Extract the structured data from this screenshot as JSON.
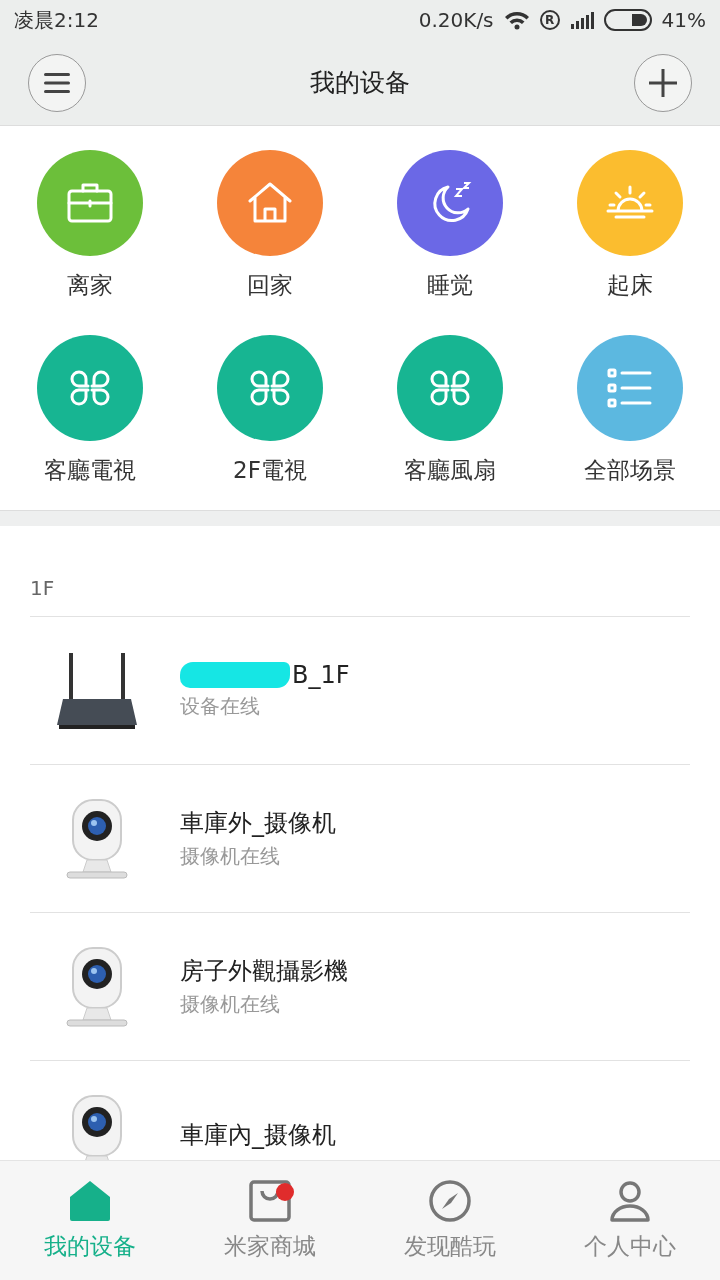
{
  "status_bar": {
    "time": "凌晨2:12",
    "speed": "0.20K/s",
    "roaming_mark": "R",
    "battery": "41%"
  },
  "header": {
    "title": "我的设备"
  },
  "scenes": [
    {
      "label": "离家",
      "kind": "briefcase",
      "color": "#6cbf3a"
    },
    {
      "label": "回家",
      "kind": "house",
      "color": "#f5843a"
    },
    {
      "label": "睡觉",
      "kind": "moon",
      "color": "#6b68e6"
    },
    {
      "label": "起床",
      "kind": "sunrise",
      "color": "#fbbd2f"
    },
    {
      "label": "客廳電視",
      "kind": "clover",
      "color": "#17b592"
    },
    {
      "label": "2F電視",
      "kind": "clover",
      "color": "#17b592"
    },
    {
      "label": "客廳風扇",
      "kind": "clover",
      "color": "#17b592"
    },
    {
      "label": "全部场景",
      "kind": "list",
      "color": "#5cb8e0"
    }
  ],
  "sections": [
    {
      "title": "1F",
      "devices": [
        {
          "name": "B_1F",
          "status": "设备在线",
          "kind": "router",
          "redacted": true
        },
        {
          "name": "車庫外_摄像机",
          "status": "摄像机在线",
          "kind": "camera",
          "redacted": false
        },
        {
          "name": "房子外觀攝影機",
          "status": "摄像机在线",
          "kind": "camera",
          "redacted": false
        },
        {
          "name": "車庫內_摄像机",
          "kind": "camera",
          "redacted": false
        }
      ]
    }
  ],
  "nav": [
    {
      "label": "我的设备",
      "kind": "home",
      "selected": true,
      "badge": false
    },
    {
      "label": "米家商城",
      "kind": "store",
      "selected": false,
      "badge": true
    },
    {
      "label": "发现酷玩",
      "kind": "compass",
      "selected": false,
      "badge": false
    },
    {
      "label": "个人中心",
      "kind": "person",
      "selected": false,
      "badge": false
    }
  ]
}
